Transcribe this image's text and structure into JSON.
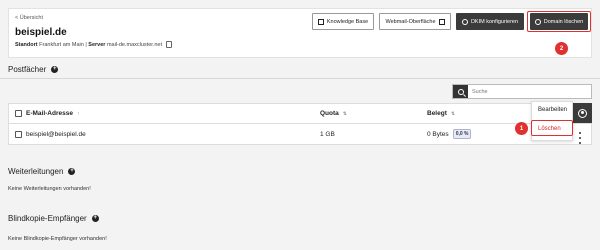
{
  "header": {
    "back_link": "< Übersicht",
    "domain": "beispiel.de",
    "standort_label": "Standort",
    "standort_value": "Frankfurt am Main",
    "separator": "|",
    "server_label": "Server",
    "server_value": "mail-de.maxcluster.net"
  },
  "toolbar": {
    "knowledge_base": "Knowledge Base",
    "webmail": "Webmail-Oberfläche",
    "dkim": "DKIM konfigurieren",
    "delete_domain": "Domain löschen"
  },
  "postfaecher": {
    "title": "Postfächer",
    "search_placeholder": "Suche",
    "columns": {
      "email": "E-Mail-Adresse",
      "quota": "Quota",
      "used": "Belegt"
    },
    "rows": [
      {
        "email": "beispiel@beispiel.de",
        "quota": "1 GB",
        "used": "0 Bytes",
        "used_percent": "0,0 %"
      }
    ]
  },
  "row_menu": {
    "edit": "Bearbeiten",
    "delete": "Löschen"
  },
  "annotations": {
    "step1": "1",
    "step2": "2",
    "highlight_color": "#e03030"
  },
  "weiterleitungen": {
    "title": "Weiterleitungen",
    "empty": "Keine Weiterleitungen vorhanden!"
  },
  "blindkopie": {
    "title": "Blindkopie-Empfänger",
    "empty": "Keine Blindkopie-Empfänger vorhanden!"
  },
  "icons": {
    "copy": "copy-icon",
    "external_link": "external-link-icon",
    "dkim": "shield-check-icon",
    "trash": "trash-icon",
    "search": "search-icon",
    "gear": "gear-icon",
    "kebab": "kebab-menu-icon",
    "add": "plus-circle-icon"
  }
}
